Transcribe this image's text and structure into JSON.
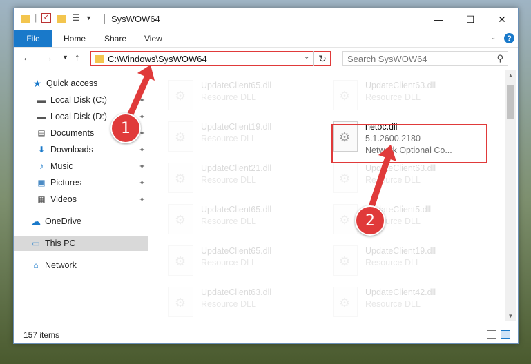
{
  "window": {
    "title": "SysWOW64",
    "controls": {
      "minimize": "—",
      "maximize": "☐",
      "close": "✕"
    }
  },
  "ribbon": {
    "tabs": [
      "File",
      "Home",
      "Share",
      "View"
    ],
    "help": "?"
  },
  "nav": {
    "address": "C:\\Windows\\SysWOW64",
    "search_placeholder": "Search SysWOW64"
  },
  "sidebar": {
    "quick_access": "Quick access",
    "items": [
      {
        "label": "Local Disk (C:)",
        "icon": "drive-icon"
      },
      {
        "label": "Local Disk (D:)",
        "icon": "drive-icon"
      },
      {
        "label": "Documents",
        "icon": "documents-icon"
      },
      {
        "label": "Downloads",
        "icon": "downloads-icon"
      },
      {
        "label": "Music",
        "icon": "music-icon"
      },
      {
        "label": "Pictures",
        "icon": "pictures-icon"
      },
      {
        "label": "Videos",
        "icon": "videos-icon"
      }
    ],
    "onedrive": "OneDrive",
    "this_pc": "This PC",
    "network": "Network"
  },
  "files": [
    {
      "name": "UpdateClient65.dll",
      "desc": "Resource DLL"
    },
    {
      "name": "UpdateClient63.dll",
      "desc": "Resource DLL"
    },
    {
      "name": "UpdateClient19.dll",
      "desc": "Resource DLL"
    },
    {
      "name": "netoc.dll",
      "desc": "5.1.2600.2180",
      "desc2": "Network Optional Co..."
    },
    {
      "name": "UpdateClient21.dll",
      "desc": "Resource DLL"
    },
    {
      "name": "UpdateClient63.dll",
      "desc": "Resource DLL"
    },
    {
      "name": "UpdateClient65.dll",
      "desc": "Resource DLL"
    },
    {
      "name": "UpdateClient5.dll",
      "desc": "Resource DLL"
    },
    {
      "name": "UpdateClient65.dll",
      "desc": "Resource DLL"
    },
    {
      "name": "UpdateClient19.dll",
      "desc": "Resource DLL"
    },
    {
      "name": "UpdateClient63.dll",
      "desc": "Resource DLL"
    },
    {
      "name": "UpdateClient42.dll",
      "desc": "Resource DLL"
    }
  ],
  "status": {
    "count": "157 items"
  },
  "callouts": {
    "one": "1",
    "two": "2"
  },
  "colors": {
    "accent": "#1979ca",
    "highlight": "#e03a3a",
    "folder": "#f3c54e"
  }
}
